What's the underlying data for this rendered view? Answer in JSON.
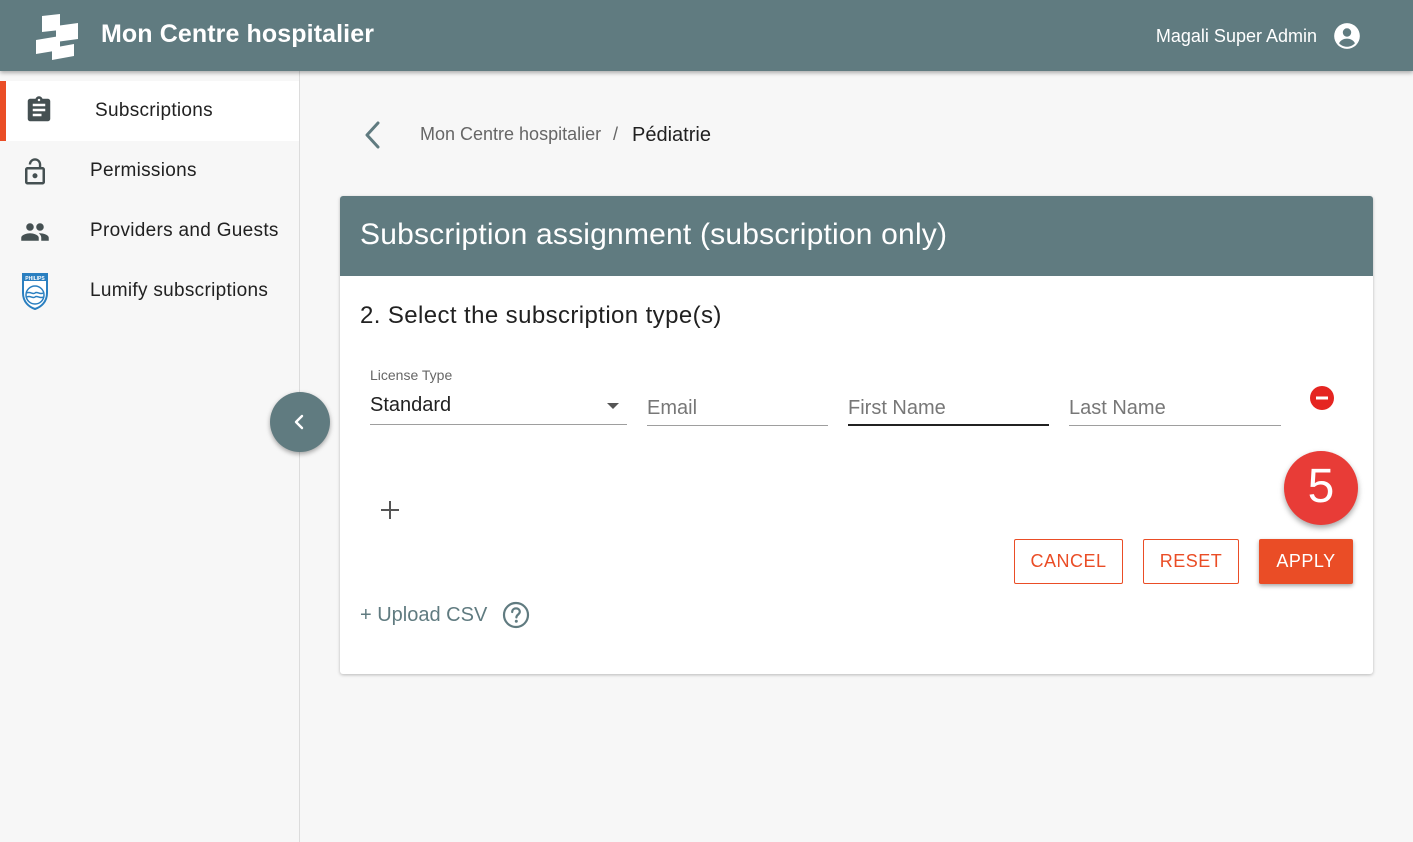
{
  "header": {
    "app_title": "Mon Centre hospitalier",
    "user_name": "Magali Super Admin",
    "logo_icon": "building-blocks-icon",
    "user_icon": "account-circle-icon",
    "color": "#607b80"
  },
  "sidebar": {
    "items": [
      {
        "label": "Subscriptions",
        "icon": "clipboard-icon",
        "active": true
      },
      {
        "label": "Permissions",
        "icon": "lock-icon",
        "active": false
      },
      {
        "label": "Providers and Guests",
        "icon": "people-icon",
        "active": false
      },
      {
        "label": "Lumify subscriptions",
        "icon": "philips-shield-icon",
        "active": false
      }
    ],
    "accent_color": "#ea4d26"
  },
  "breadcrumb": {
    "items": [
      "Mon Centre hospitalier",
      "Pédiatrie"
    ],
    "separator": "/"
  },
  "card": {
    "title": "Subscription assignment (subscription only)",
    "step_title": "2. Select the subscription type(s)",
    "license_type_label": "License Type",
    "license_type_value": "Standard",
    "email_placeholder": "Email",
    "first_name_placeholder": "First Name",
    "last_name_placeholder": "Last Name",
    "upload_csv_label": "+ Upload CSV",
    "buttons": {
      "cancel": "CANCEL",
      "reset": "RESET",
      "apply": "APPLY"
    }
  },
  "step_badge": "5",
  "colors": {
    "primary": "#607b80",
    "accent": "#ea4d26",
    "remove": "#e52521"
  }
}
